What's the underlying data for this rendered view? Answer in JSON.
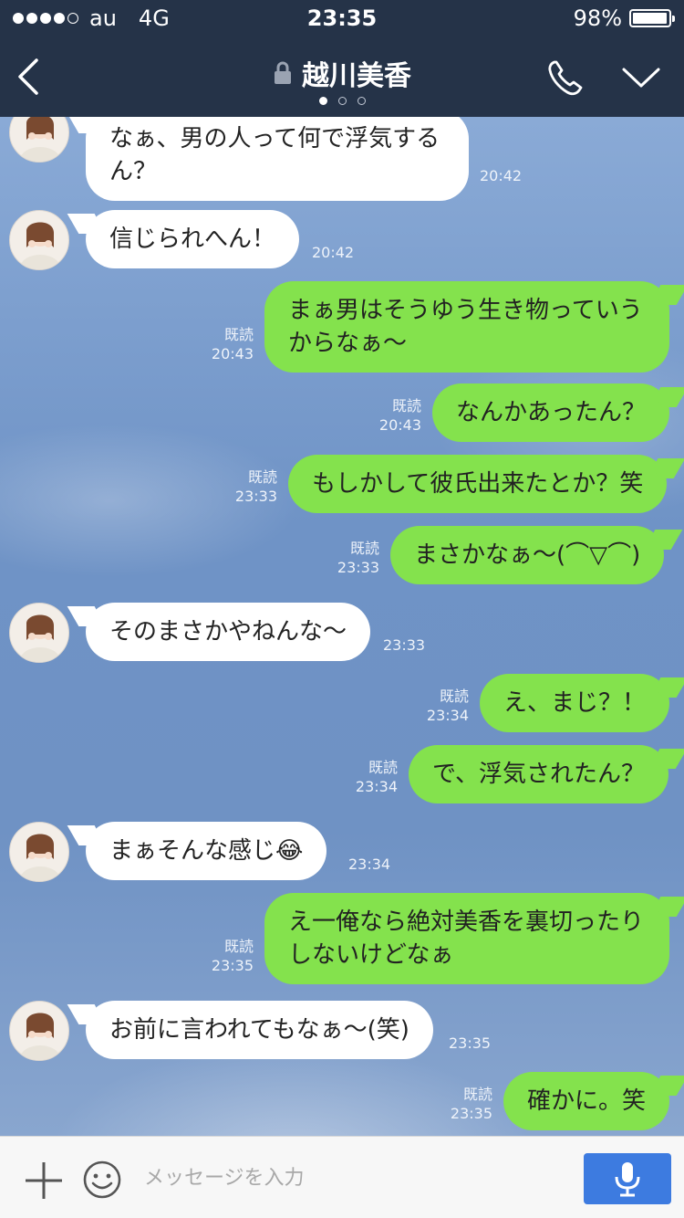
{
  "status_bar": {
    "carrier": "au",
    "network": "4G",
    "time": "23:35",
    "battery": "98%",
    "battery_level": 0.98
  },
  "header": {
    "title": "越川美香",
    "page_count": 3,
    "active_page": 1
  },
  "messages": [
    {
      "side": "in",
      "text": "なぁ、男の人って何で浮気する\nん？",
      "time": "20:42"
    },
    {
      "side": "in",
      "text": "信じられへん！",
      "time": "20:42"
    },
    {
      "side": "out",
      "text": "まぁ男はそうゆう生き物っていう\nからなぁ〜",
      "read": "既読",
      "time": "20:43"
    },
    {
      "side": "out",
      "text": "なんかあったん？",
      "read": "既読",
      "time": "20:43"
    },
    {
      "side": "out",
      "text": "もしかして彼氏出来たとか？笑",
      "read": "既読",
      "time": "23:33"
    },
    {
      "side": "out",
      "text": "まさかなぁ〜(⌒▽⌒)",
      "read": "既読",
      "time": "23:33"
    },
    {
      "side": "in",
      "text": "そのまさかやねんな〜",
      "time": "23:33"
    },
    {
      "side": "out",
      "text": "え、まじ？！",
      "read": "既読",
      "time": "23:34"
    },
    {
      "side": "out",
      "text": "で、浮気されたん？",
      "read": "既読",
      "time": "23:34"
    },
    {
      "side": "in",
      "text": "まぁそんな感じ😂",
      "time": "23:34"
    },
    {
      "side": "out",
      "text": "え一俺なら絶対美香を裏切ったり\nしないけどなぁ",
      "read": "既読",
      "time": "23:35"
    },
    {
      "side": "in",
      "text": "お前に言われてもなぁ〜(笑)",
      "time": "23:35"
    },
    {
      "side": "out",
      "text": "確かに。笑",
      "read": "既読",
      "time": "23:35"
    }
  ],
  "input": {
    "placeholder": "メッセージを入力",
    "value": ""
  },
  "colors": {
    "header_bg": "#253348",
    "outgoing_bubble": "#84e24d",
    "incoming_bubble": "#ffffff",
    "mic_button": "#3d7be0"
  }
}
